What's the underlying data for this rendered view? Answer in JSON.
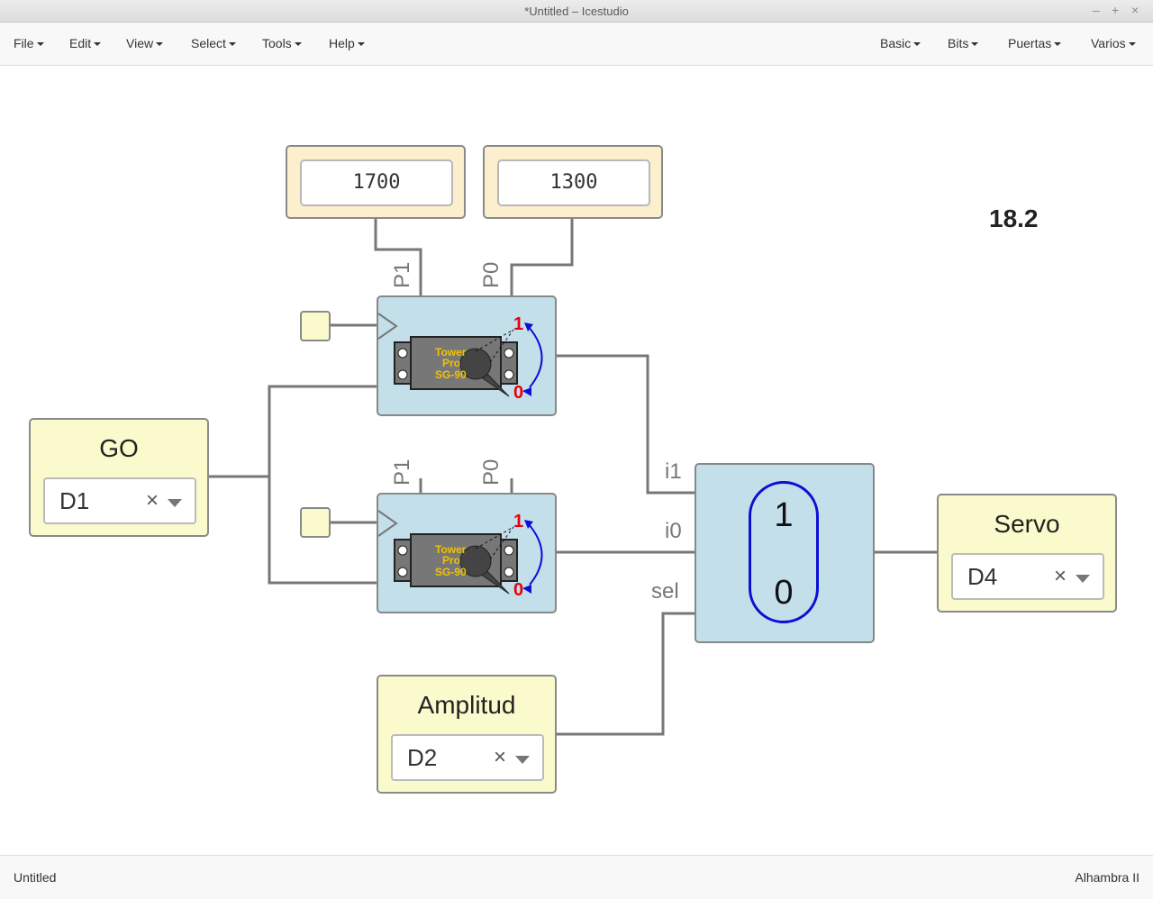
{
  "window": {
    "title": "*Untitled – Icestudio",
    "min": "–",
    "max": "+",
    "close": "×"
  },
  "menubar": {
    "left": [
      "File",
      "Edit",
      "View",
      "Select",
      "Tools",
      "Help"
    ],
    "right": [
      "Basic",
      "Bits",
      "Puertas",
      "Varios"
    ]
  },
  "blocks": {
    "const_p1": "1700",
    "const_p0": "1300",
    "version": "18.2",
    "go": {
      "name": "GO",
      "pin": "D1"
    },
    "amplitud": {
      "name": "Amplitud",
      "pin": "D2"
    },
    "servo": {
      "name": "Servo",
      "pin": "D4"
    },
    "servo_top": {
      "p1": "P1",
      "p0": "P0",
      "one": "1",
      "zero": "0",
      "label_line1": "Tower",
      "label_line2": "Pro",
      "label_line3": "SG-90"
    },
    "servo_bottom": {
      "p1": "P1",
      "p0": "P0",
      "one": "1",
      "zero": "0",
      "label_line1": "Tower",
      "label_line2": "Pro",
      "label_line3": "SG-90"
    },
    "mux": {
      "in1": "i1",
      "in0": "i0",
      "sel": "sel",
      "one": "1",
      "zero": "0"
    },
    "clear_glyph": "×"
  },
  "statusbar": {
    "left": "Untitled",
    "right": "Alhambra II"
  },
  "colors": {
    "servo_fill": "#c3dfea",
    "pin_fill": "#fbfacd",
    "const_fill": "#fbefcd",
    "mux_pill": "#0b10d6",
    "servo_red": "#e8000b",
    "servo_label": "#f2c200",
    "wire": "#777777"
  }
}
